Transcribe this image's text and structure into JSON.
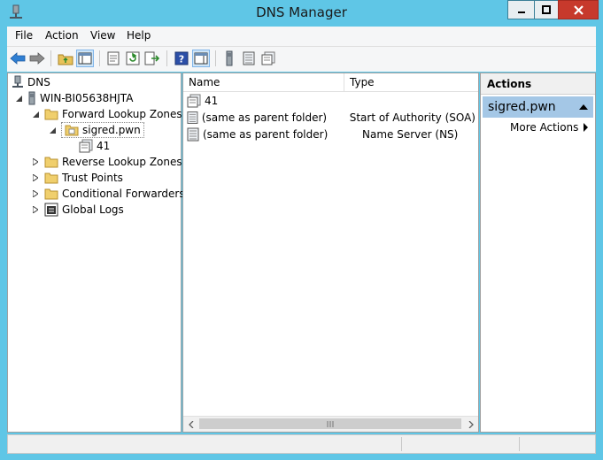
{
  "window": {
    "title": "DNS Manager"
  },
  "menubar": {
    "items": [
      "File",
      "Action",
      "View",
      "Help"
    ]
  },
  "tree": {
    "root": "DNS",
    "server": "WIN-BI05638HJTA",
    "forward_zones": "Forward Lookup Zones",
    "zone": "sigred.pwn",
    "subdomain": "41",
    "reverse_zones": "Reverse Lookup Zones",
    "trust_points": "Trust Points",
    "conditional_forwarders": "Conditional Forwarders",
    "global_logs": "Global Logs"
  },
  "list": {
    "columns": {
      "name": "Name",
      "type": "Type"
    },
    "rows": [
      {
        "name": "41",
        "type": ""
      },
      {
        "name": "(same as parent folder)",
        "type": "Start of Authority (SOA)"
      },
      {
        "name": "(same as parent folder)",
        "type": "Name Server (NS)"
      }
    ]
  },
  "actions": {
    "header": "Actions",
    "group": "sigred.pwn",
    "more": "More Actions"
  },
  "icons": {
    "back": "back-arrow-icon",
    "forward": "forward-arrow-icon",
    "up": "up-folder-icon",
    "show-tree": "console-tree-icon",
    "export": "export-list-icon",
    "refresh": "refresh-icon",
    "help": "help-icon",
    "action-pane": "action-pane-icon"
  },
  "colors": {
    "titlebar": "#5fc6e6",
    "close": "#c7392c",
    "selected_group": "#a4c7e6"
  }
}
